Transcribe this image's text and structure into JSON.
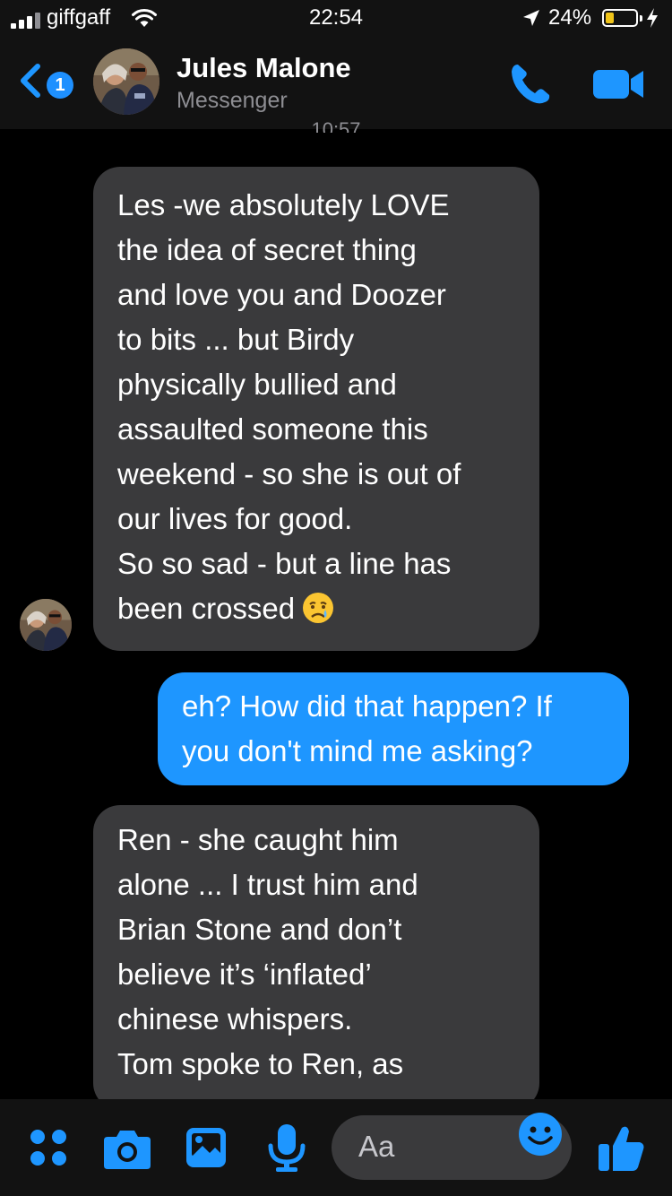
{
  "status_bar": {
    "carrier": "giffgaff",
    "time": "22:54",
    "battery_percent": "24%",
    "battery_level": 0.24
  },
  "header": {
    "unread_badge": "1",
    "contact_name": "Jules Malone",
    "subtitle": "Messenger",
    "partial_timestamp": "10:57"
  },
  "messages": [
    {
      "direction": "incoming",
      "text": "Les -we absolutely LOVE\nthe idea of secret thing\nand love you and Doozer\nto bits ... but Birdy\nphysically bullied and\nassaulted someone this\nweekend - so she is out of\nour lives for good.\nSo so sad - but a line has\nbeen crossed",
      "emoji": "crying-face"
    },
    {
      "direction": "outgoing",
      "text": "eh? How did that happen? If\nyou don't mind me asking?"
    },
    {
      "direction": "incoming",
      "text": "Ren - she caught him\nalone ... I trust him and\nBrian Stone and don’t\nbelieve it’s ‘inflated’\nchinese whispers.\nTom spoke to Ren, as"
    }
  ],
  "composer": {
    "placeholder": "Aa",
    "icons": [
      "apps-icon",
      "camera-icon",
      "gallery-icon",
      "microphone-icon",
      "emoji-icon",
      "like-icon"
    ]
  },
  "colors": {
    "accent": "#1e96ff",
    "incoming_bubble": "#3a3a3c",
    "bar_background": "#121212",
    "battery_fill": "#f0c419"
  }
}
